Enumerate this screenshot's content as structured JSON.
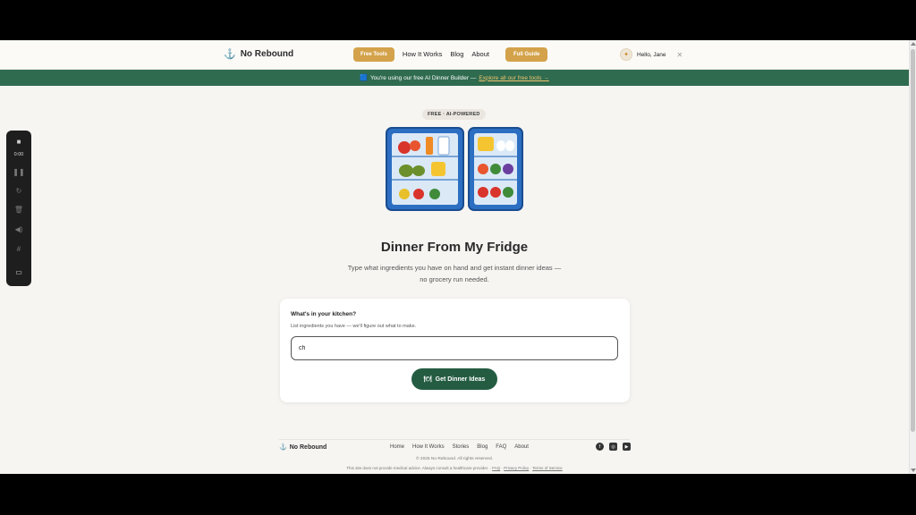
{
  "header": {
    "brand": "No Rebound",
    "nav": {
      "free_tools": "Free Tools",
      "how_it_works": "How It Works",
      "blog": "Blog",
      "about": "About",
      "full_guide": "Full Guide"
    },
    "user_greeting": "Hello, Jane"
  },
  "banner": {
    "text": "You're using our free AI Dinner Builder —",
    "link": "Explore all our free tools →"
  },
  "hero": {
    "badge": "FREE · AI-POWERED",
    "title": "Dinner From My Fridge",
    "subtitle": "Type what ingredients you have on hand and get instant dinner ideas — no grocery run needed."
  },
  "form": {
    "title": "What's in your kitchen?",
    "help": "List ingredients you have — we'll figure out what to make.",
    "input_value": "ch",
    "cta": "Get Dinner Ideas"
  },
  "footer": {
    "brand": "No Rebound",
    "nav": [
      "Home",
      "How It Works",
      "Stories",
      "Blog",
      "FAQ",
      "About"
    ],
    "copyright": "© 2025 No Rebound. All rights reserved.",
    "disclaimer": "This site does not provide medical advice. Always consult a healthcare provider.",
    "links": [
      "FAQ",
      "Privacy Policy",
      "Terms of Service"
    ]
  },
  "recorder": {
    "time": "0:00"
  },
  "colors": {
    "accent_gold": "#d4a24a",
    "banner_green": "#2f6b4f",
    "cta_green": "#245c42",
    "page_bg": "#f6f5f2"
  }
}
